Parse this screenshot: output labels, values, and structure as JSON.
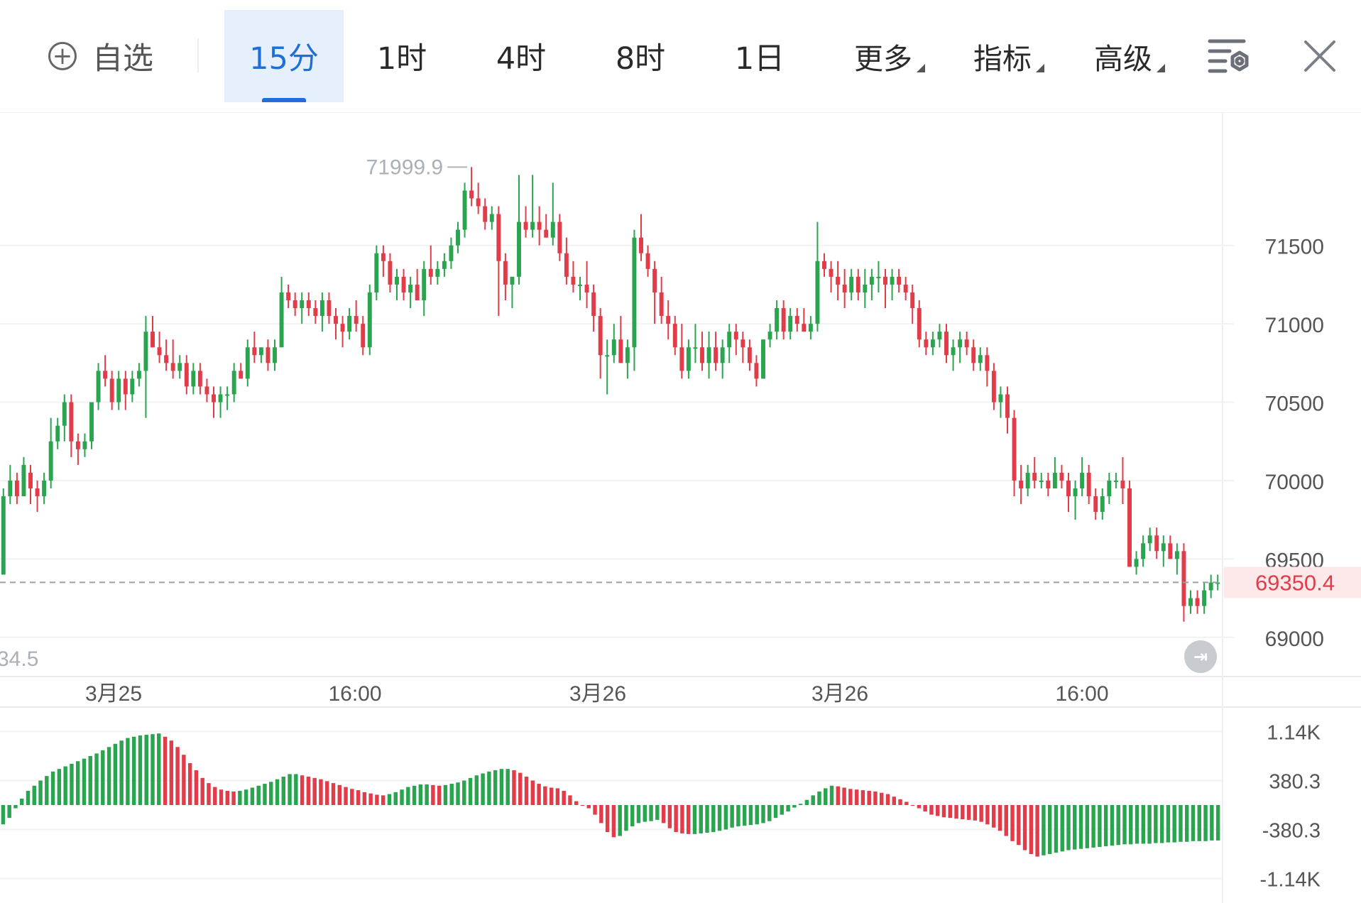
{
  "toolbar": {
    "watchlist": {
      "icon": "plus-circle-icon",
      "label": "自选"
    },
    "intervals": [
      "15分",
      "1时",
      "4时",
      "8时",
      "1日"
    ],
    "active_interval": "15分",
    "more_label": "更多",
    "indicators_label": "指标",
    "advanced_label": "高级",
    "settings_icon": "chart-settings-icon",
    "close_icon": "close-icon"
  },
  "colors": {
    "up": "#2aa44f",
    "down": "#e03c4a",
    "accent": "#1f6fd8",
    "price_tag": "#e03c4a"
  },
  "chart_data": {
    "type": "candlestick",
    "timeframe": "15分",
    "y_ticks": [
      71500,
      71000,
      70500,
      70000,
      69500,
      69000
    ],
    "ylim": [
      68750,
      72350
    ],
    "x_tick_labels": [
      "3月25",
      "16:00",
      "3月26",
      "3月26",
      "16:00"
    ],
    "high_marker": "71999.9",
    "low_marker_partial": "34.5",
    "last_price": "69350.4",
    "grid": true,
    "candles": [
      [
        69400,
        69950,
        69400,
        69900
      ],
      [
        69900,
        70100,
        69850,
        70000
      ],
      [
        70000,
        70050,
        69850,
        69900
      ],
      [
        69900,
        70150,
        69900,
        70100
      ],
      [
        70050,
        70100,
        69850,
        69950
      ],
      [
        69950,
        70000,
        69800,
        69900
      ],
      [
        69900,
        70050,
        69850,
        70000
      ],
      [
        70000,
        70400,
        69950,
        70250
      ],
      [
        70250,
        70400,
        70200,
        70350
      ],
      [
        70350,
        70550,
        70250,
        70500
      ],
      [
        70500,
        70550,
        70150,
        70250
      ],
      [
        70250,
        70300,
        70100,
        70200
      ],
      [
        70200,
        70300,
        70150,
        70250
      ],
      [
        70250,
        70500,
        70200,
        70500
      ],
      [
        70500,
        70750,
        70450,
        70700
      ],
      [
        70700,
        70800,
        70600,
        70650
      ],
      [
        70650,
        70700,
        70450,
        70500
      ],
      [
        70500,
        70700,
        70450,
        70650
      ],
      [
        70650,
        70700,
        70450,
        70550
      ],
      [
        70550,
        70700,
        70500,
        70650
      ],
      [
        70650,
        70750,
        70600,
        70700
      ],
      [
        70700,
        71050,
        70400,
        70950
      ],
      [
        70950,
        71050,
        70850,
        70850
      ],
      [
        70850,
        70950,
        70750,
        70800
      ],
      [
        70800,
        70900,
        70700,
        70750
      ],
      [
        70750,
        70900,
        70650,
        70700
      ],
      [
        70700,
        70800,
        70650,
        70750
      ],
      [
        70750,
        70800,
        70550,
        70600
      ],
      [
        70600,
        70750,
        70550,
        70700
      ],
      [
        70700,
        70750,
        70550,
        70600
      ],
      [
        70600,
        70650,
        70500,
        70550
      ],
      [
        70550,
        70600,
        70400,
        70500
      ],
      [
        70500,
        70600,
        70400,
        70550
      ],
      [
        70550,
        70600,
        70450,
        70550
      ],
      [
        70550,
        70750,
        70500,
        70700
      ],
      [
        70700,
        70750,
        70650,
        70650
      ],
      [
        70650,
        70900,
        70600,
        70850
      ],
      [
        70850,
        70950,
        70750,
        70800
      ],
      [
        70800,
        70850,
        70750,
        70850
      ],
      [
        70850,
        70900,
        70700,
        70750
      ],
      [
        70750,
        70900,
        70700,
        70850
      ],
      [
        70850,
        71300,
        70850,
        71200
      ],
      [
        71200,
        71250,
        71100,
        71150
      ],
      [
        71150,
        71200,
        71050,
        71100
      ],
      [
        71100,
        71200,
        71000,
        71150
      ],
      [
        71150,
        71200,
        71050,
        71100
      ],
      [
        71100,
        71150,
        71000,
        71050
      ],
      [
        71050,
        71200,
        70950,
        71150
      ],
      [
        71150,
        71200,
        71000,
        71050
      ],
      [
        71050,
        71100,
        70900,
        71000
      ],
      [
        71000,
        71050,
        70850,
        70950
      ],
      [
        70950,
        71100,
        70900,
        71050
      ],
      [
        71050,
        71150,
        70950,
        71000
      ],
      [
        71000,
        71050,
        70800,
        70850
      ],
      [
        70850,
        71250,
        70800,
        71200
      ],
      [
        71200,
        71500,
        71150,
        71450
      ],
      [
        71450,
        71500,
        71300,
        71400
      ],
      [
        71400,
        71450,
        71200,
        71250
      ],
      [
        71250,
        71350,
        71150,
        71300
      ],
      [
        71300,
        71350,
        71150,
        71200
      ],
      [
        71200,
        71300,
        71100,
        71250
      ],
      [
        71250,
        71350,
        71150,
        71150
      ],
      [
        71150,
        71400,
        71050,
        71350
      ],
      [
        71350,
        71500,
        71250,
        71300
      ],
      [
        71300,
        71400,
        71250,
        71350
      ],
      [
        71350,
        71450,
        71300,
        71400
      ],
      [
        71400,
        71550,
        71350,
        71500
      ],
      [
        71500,
        71650,
        71450,
        71600
      ],
      [
        71600,
        71900,
        71550,
        71850
      ],
      [
        71850,
        71999.9,
        71750,
        71800
      ],
      [
        71800,
        71900,
        71700,
        71750
      ],
      [
        71750,
        71800,
        71600,
        71650
      ],
      [
        71650,
        71750,
        71600,
        71700
      ],
      [
        71700,
        71750,
        71050,
        71400
      ],
      [
        71400,
        71450,
        71150,
        71250
      ],
      [
        71250,
        71300,
        71100,
        71300
      ],
      [
        71300,
        71950,
        71250,
        71650
      ],
      [
        71650,
        71750,
        71550,
        71600
      ],
      [
        71600,
        71950,
        71550,
        71650
      ],
      [
        71650,
        71750,
        71500,
        71600
      ],
      [
        71600,
        71700,
        71550,
        71550
      ],
      [
        71550,
        71900,
        71500,
        71650
      ],
      [
        71650,
        71700,
        71400,
        71450
      ],
      [
        71450,
        71550,
        71250,
        71300
      ],
      [
        71300,
        71400,
        71200,
        71250
      ],
      [
        71250,
        71300,
        71150,
        71250
      ],
      [
        71250,
        71400,
        71100,
        71200
      ],
      [
        71200,
        71250,
        70950,
        71050
      ],
      [
        71050,
        71100,
        70650,
        70800
      ],
      [
        70800,
        70900,
        70550,
        70800
      ],
      [
        70800,
        71000,
        70750,
        70900
      ],
      [
        70900,
        71050,
        70800,
        70750
      ],
      [
        70750,
        70900,
        70650,
        70850
      ],
      [
        70850,
        71600,
        70700,
        71550
      ],
      [
        71550,
        71700,
        71400,
        71450
      ],
      [
        71450,
        71500,
        71300,
        71350
      ],
      [
        71350,
        71400,
        71000,
        71200
      ],
      [
        71200,
        71300,
        71000,
        71050
      ],
      [
        71050,
        71150,
        70900,
        71000
      ],
      [
        71000,
        71050,
        70800,
        70850
      ],
      [
        70850,
        71000,
        70650,
        70700
      ],
      [
        70700,
        70900,
        70650,
        70850
      ],
      [
        70850,
        71000,
        70750,
        70850
      ],
      [
        70850,
        70950,
        70700,
        70750
      ],
      [
        70750,
        70950,
        70650,
        70850
      ],
      [
        70850,
        70950,
        70700,
        70750
      ],
      [
        70750,
        70900,
        70650,
        70850
      ],
      [
        70850,
        71000,
        70750,
        70950
      ],
      [
        70950,
        71000,
        70800,
        70900
      ],
      [
        70900,
        70950,
        70750,
        70850
      ],
      [
        70850,
        70900,
        70700,
        70750
      ],
      [
        70750,
        70800,
        70600,
        70650
      ],
      [
        70650,
        70900,
        70650,
        70900
      ],
      [
        70900,
        71000,
        70850,
        70950
      ],
      [
        70950,
        71150,
        70900,
        71100
      ],
      [
        71100,
        71150,
        70900,
        70950
      ],
      [
        70950,
        71100,
        70900,
        71050
      ],
      [
        71050,
        71100,
        70950,
        71000
      ],
      [
        71000,
        71100,
        70950,
        70950
      ],
      [
        70950,
        71050,
        70900,
        71000
      ],
      [
        71000,
        71650,
        70950,
        71400
      ],
      [
        71400,
        71450,
        71300,
        71350
      ],
      [
        71350,
        71400,
        71200,
        71300
      ],
      [
        71300,
        71400,
        71150,
        71250
      ],
      [
        71250,
        71350,
        71100,
        71200
      ],
      [
        71200,
        71350,
        71150,
        71300
      ],
      [
        71300,
        71350,
        71150,
        71200
      ],
      [
        71200,
        71350,
        71100,
        71250
      ],
      [
        71250,
        71350,
        71150,
        71300
      ],
      [
        71300,
        71400,
        71200,
        71300
      ],
      [
        71300,
        71350,
        71100,
        71250
      ],
      [
        71250,
        71350,
        71150,
        71300
      ],
      [
        71300,
        71350,
        71200,
        71250
      ],
      [
        71250,
        71300,
        71150,
        71200
      ],
      [
        71200,
        71250,
        71000,
        71100
      ],
      [
        71100,
        71150,
        70850,
        70900
      ],
      [
        70900,
        70950,
        70800,
        70850
      ],
      [
        70850,
        70950,
        70800,
        70900
      ],
      [
        70900,
        71000,
        70850,
        70950
      ],
      [
        70950,
        71000,
        70750,
        70800
      ],
      [
        70800,
        70900,
        70700,
        70850
      ],
      [
        70850,
        70950,
        70750,
        70900
      ],
      [
        70900,
        70950,
        70800,
        70850
      ],
      [
        70850,
        70900,
        70700,
        70750
      ],
      [
        70750,
        70850,
        70700,
        70800
      ],
      [
        70800,
        70850,
        70600,
        70700
      ],
      [
        70700,
        70750,
        70450,
        70500
      ],
      [
        70500,
        70600,
        70400,
        70550
      ],
      [
        70550,
        70600,
        70300,
        70400
      ],
      [
        70400,
        70450,
        69900,
        70000
      ],
      [
        70000,
        70100,
        69850,
        69950
      ],
      [
        69950,
        70100,
        69900,
        70050
      ],
      [
        70050,
        70150,
        69950,
        70000
      ],
      [
        70000,
        70050,
        69950,
        70000
      ],
      [
        70000,
        70050,
        69900,
        69950
      ],
      [
        69950,
        70150,
        69950,
        70050
      ],
      [
        70050,
        70100,
        69950,
        70000
      ],
      [
        70000,
        70050,
        69800,
        69900
      ],
      [
        69900,
        70000,
        69750,
        69950
      ],
      [
        69950,
        70150,
        69900,
        70050
      ],
      [
        70050,
        70100,
        69850,
        69900
      ],
      [
        69900,
        69950,
        69750,
        69800
      ],
      [
        69800,
        69950,
        69750,
        69900
      ],
      [
        69900,
        70050,
        69850,
        70000
      ],
      [
        70000,
        70050,
        69950,
        70000
      ],
      [
        70000,
        70150,
        69850,
        69950
      ],
      [
        69950,
        70000,
        69450,
        69450
      ],
      [
        69450,
        69550,
        69400,
        69500
      ],
      [
        69500,
        69650,
        69450,
        69600
      ],
      [
        69600,
        69700,
        69550,
        69650
      ],
      [
        69650,
        69700,
        69500,
        69550
      ],
      [
        69550,
        69650,
        69450,
        69600
      ],
      [
        69600,
        69650,
        69500,
        69500
      ],
      [
        69500,
        69600,
        69400,
        69550
      ],
      [
        69550,
        69600,
        69100,
        69200
      ],
      [
        69200,
        69300,
        69150,
        69250
      ],
      [
        69250,
        69300,
        69150,
        69200
      ],
      [
        69200,
        69350,
        69150,
        69300
      ],
      [
        69300,
        69400,
        69250,
        69350
      ],
      [
        69350,
        69400,
        69300,
        69350
      ]
    ],
    "macd": {
      "yticks": [
        "1.14K",
        "380.3",
        "-380.3",
        "-1.14K"
      ],
      "ylim": [
        -1520,
        1520
      ],
      "values": [
        -300,
        -200,
        -50,
        100,
        220,
        300,
        380,
        450,
        520,
        560,
        600,
        640,
        680,
        720,
        760,
        800,
        850,
        900,
        950,
        1000,
        1040,
        1060,
        1080,
        1090,
        1100,
        1110,
        1060,
        1000,
        900,
        780,
        650,
        540,
        420,
        340,
        280,
        240,
        220,
        210,
        220,
        240,
        270,
        300,
        330,
        360,
        400,
        440,
        480,
        480,
        460,
        440,
        420,
        400,
        370,
        340,
        310,
        280,
        250,
        230,
        200,
        180,
        160,
        150,
        170,
        200,
        240,
        280,
        300,
        320,
        320,
        310,
        300,
        310,
        330,
        350,
        380,
        420,
        460,
        490,
        520,
        540,
        560,
        560,
        540,
        500,
        440,
        380,
        330,
        290,
        270,
        260,
        220,
        150,
        60,
        0,
        -50,
        -150,
        -280,
        -420,
        -500,
        -480,
        -400,
        -330,
        -280,
        -260,
        -250,
        -230,
        -280,
        -360,
        -420,
        -440,
        -450,
        -450,
        -440,
        -430,
        -420,
        -400,
        -380,
        -350,
        -330,
        -320,
        -310,
        -300,
        -280,
        -250,
        -200,
        -150,
        -100,
        -40,
        20,
        80,
        150,
        210,
        260,
        300,
        290,
        270,
        250,
        240,
        230,
        220,
        210,
        190,
        170,
        130,
        90,
        50,
        0,
        -50,
        -100,
        -150,
        -170,
        -190,
        -200,
        -210,
        -220,
        -230,
        -240,
        -260,
        -300,
        -350,
        -400,
        -480,
        -560,
        -620,
        -700,
        -760,
        -800,
        -780,
        -760,
        -740,
        -720,
        -700,
        -690,
        -680,
        -670,
        -660,
        -650,
        -640,
        -630,
        -620,
        -610,
        -610,
        -600,
        -600,
        -600,
        -590,
        -590,
        -580,
        -580,
        -570,
        -570,
        -560,
        -560,
        -560,
        -550,
        -550
      ]
    }
  }
}
